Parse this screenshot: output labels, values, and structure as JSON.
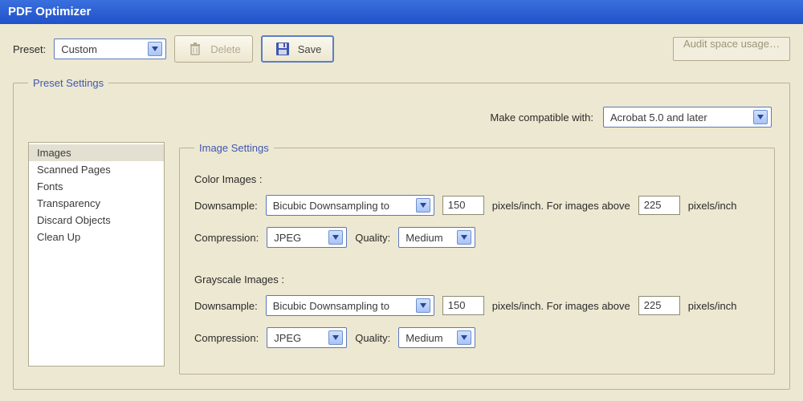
{
  "window": {
    "title": "PDF Optimizer"
  },
  "toolbar": {
    "preset_label": "Preset:",
    "preset_value": "Custom",
    "delete_label": "Delete",
    "save_label": "Save",
    "audit_label": "Audit space usage…"
  },
  "preset_settings": {
    "legend": "Preset Settings",
    "compat_label": "Make compatible with:",
    "compat_value": "Acrobat 5.0 and later"
  },
  "categories": [
    "Images",
    "Scanned Pages",
    "Fonts",
    "Transparency",
    "Discard Objects",
    "Clean Up"
  ],
  "image_settings": {
    "legend": "Image Settings",
    "color": {
      "heading": "Color Images :",
      "downsample_label": "Downsample:",
      "downsample_method": "Bicubic Downsampling to",
      "ppi": "150",
      "ppi_label": "pixels/inch. For images above",
      "above": "225",
      "unit": "pixels/inch",
      "compression_label": "Compression:",
      "compression_value": "JPEG",
      "quality_label": "Quality:",
      "quality_value": "Medium"
    },
    "gray": {
      "heading": "Grayscale Images :",
      "downsample_label": "Downsample:",
      "downsample_method": "Bicubic Downsampling to",
      "ppi": "150",
      "ppi_label": "pixels/inch. For images above",
      "above": "225",
      "unit": "pixels/inch",
      "compression_label": "Compression:",
      "compression_value": "JPEG",
      "quality_label": "Quality:",
      "quality_value": "Medium"
    }
  }
}
